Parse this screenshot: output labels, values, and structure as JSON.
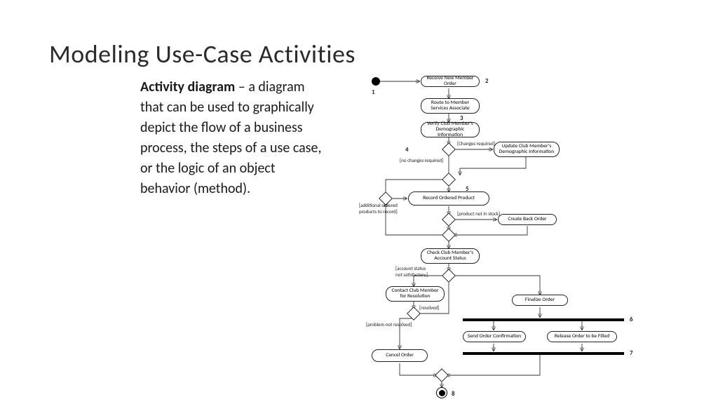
{
  "title": "Modeling Use-Case Activities",
  "definition": {
    "term": "Activity diagram",
    "body": " – a diagram that can be used to graphically depict the flow of a business process, the steps of a use case, or the logic of an object behavior (method)."
  },
  "nodes": {
    "n1": "Receive New Member Order",
    "n2": "Route to\nMember Services Associate",
    "n3": "Verify Club Member's\nDemographic Information",
    "n4": "Update Club Member's\nDemographic Information",
    "n5": "Record Ordered Product",
    "n6": "Create Back Order",
    "n7": "Check Club Member's\nAccount Status",
    "n8": "Contact Club Member\nfor Resolution",
    "n9": "Finalize Order",
    "n10": "Cancel Order",
    "n11": "Send Order Confirmation",
    "n12": "Release Order to be Filled"
  },
  "guards": {
    "g_changes": "[Changes required]",
    "g_nochanges": "[no changes required]",
    "g_additional": "[additional ordered\nproducts to record]",
    "g_not_stock": "[product not in stock]",
    "g_acct_bad": "[account status\nnot satisfactory]",
    "g_resolved": "[resolved]",
    "g_not_resolved": "[problem not resolved]"
  },
  "numbers": {
    "m1": "1",
    "m2": "2",
    "m3": "3",
    "m4": "4",
    "m5": "5",
    "m6": "6",
    "m7": "7",
    "m8": "8"
  }
}
